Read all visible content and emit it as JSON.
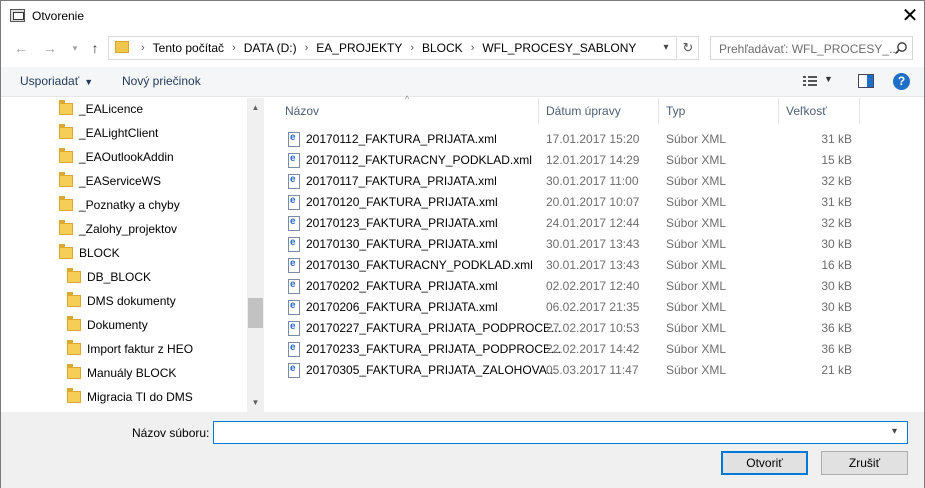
{
  "window": {
    "title": "Otvorenie"
  },
  "address": {
    "crumbs": [
      "Tento počítač",
      "DATA (D:)",
      "EA_PROJEKTY",
      "BLOCK",
      "WFL_PROCESY_SABLONY"
    ]
  },
  "search": {
    "placeholder": "Prehľadávať: WFL_PROCESY_..."
  },
  "toolbar": {
    "organize": "Usporiadať",
    "new_folder": "Nový priečinok"
  },
  "tree": {
    "items": [
      {
        "label": "_EALicence",
        "level": 1
      },
      {
        "label": "_EALightClient",
        "level": 1
      },
      {
        "label": "_EAOutlookAddin",
        "level": 1
      },
      {
        "label": "_EAServiceWS",
        "level": 1
      },
      {
        "label": "_Poznatky a chyby",
        "level": 1
      },
      {
        "label": "_Zalohy_projektov",
        "level": 1
      },
      {
        "label": "BLOCK",
        "level": 1
      },
      {
        "label": "DB_BLOCK",
        "level": 2
      },
      {
        "label": "DMS dokumenty",
        "level": 2
      },
      {
        "label": "Dokumenty",
        "level": 2
      },
      {
        "label": "Import faktur z HEO",
        "level": 2
      },
      {
        "label": "Manuály BLOCK",
        "level": 2
      },
      {
        "label": "Migracia TI do DMS",
        "level": 2
      }
    ]
  },
  "list": {
    "columns": [
      "Názov",
      "Dátum úpravy",
      "Typ",
      "Veľkosť"
    ],
    "rows": [
      {
        "name": "20170112_FAKTURA_PRIJATA.xml",
        "date": "17.01.2017 15:20",
        "type": "Súbor XML",
        "size": "31 kB"
      },
      {
        "name": "20170112_FAKTURACNY_PODKLAD.xml",
        "date": "12.01.2017 14:29",
        "type": "Súbor XML",
        "size": "15 kB"
      },
      {
        "name": "20170117_FAKTURA_PRIJATA.xml",
        "date": "30.01.2017 11:00",
        "type": "Súbor XML",
        "size": "32 kB"
      },
      {
        "name": "20170120_FAKTURA_PRIJATA.xml",
        "date": "20.01.2017 10:07",
        "type": "Súbor XML",
        "size": "31 kB"
      },
      {
        "name": "20170123_FAKTURA_PRIJATA.xml",
        "date": "24.01.2017 12:44",
        "type": "Súbor XML",
        "size": "32 kB"
      },
      {
        "name": "20170130_FAKTURA_PRIJATA.xml",
        "date": "30.01.2017 13:43",
        "type": "Súbor XML",
        "size": "30 kB"
      },
      {
        "name": "20170130_FAKTURACNY_PODKLAD.xml",
        "date": "30.01.2017 13:43",
        "type": "Súbor XML",
        "size": "16 kB"
      },
      {
        "name": "20170202_FAKTURA_PRIJATA.xml",
        "date": "02.02.2017 12:40",
        "type": "Súbor XML",
        "size": "30 kB"
      },
      {
        "name": "20170206_FAKTURA_PRIJATA.xml",
        "date": "06.02.2017 21:35",
        "type": "Súbor XML",
        "size": "30 kB"
      },
      {
        "name": "20170227_FAKTURA_PRIJATA_PODPROCE...",
        "date": "27.02.2017 10:53",
        "type": "Súbor XML",
        "size": "36 kB"
      },
      {
        "name": "20170233_FAKTURA_PRIJATA_PODPROCE...",
        "date": "22.02.2017 14:42",
        "type": "Súbor XML",
        "size": "36 kB"
      },
      {
        "name": "20170305_FAKTURA_PRIJATA_ZALOHOVA...",
        "date": "05.03.2017 11:47",
        "type": "Súbor XML",
        "size": "21 kB"
      }
    ]
  },
  "footer": {
    "filename_label": "Názov súboru:",
    "filename_value": "",
    "open": "Otvoriť",
    "cancel": "Zrušiť"
  },
  "colors": {
    "accent": "#0078d7",
    "header_text": "#4c607a",
    "folder": "#f6cd57"
  }
}
